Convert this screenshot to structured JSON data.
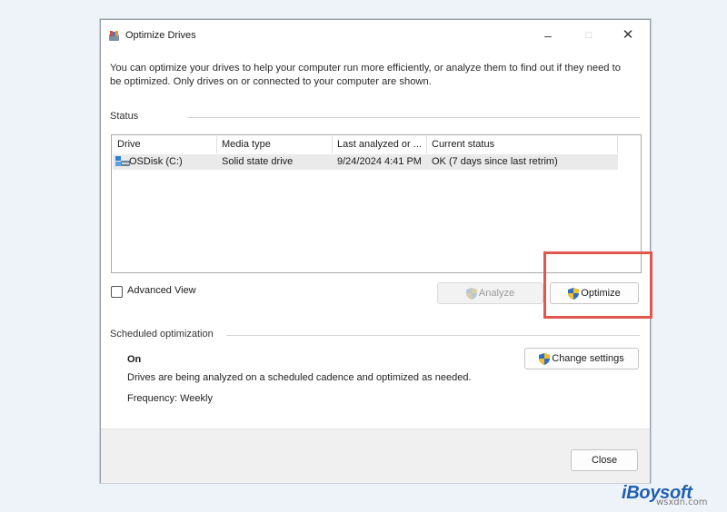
{
  "window": {
    "title": "Optimize Drives",
    "minimize_glyph": "–",
    "maximize_glyph": "□",
    "close_glyph": "✕"
  },
  "description": "You can optimize your drives to help your computer run more efficiently, or analyze them to find out if they need to be optimized. Only drives on or connected to your computer are shown.",
  "status": {
    "label": "Status",
    "columns": [
      "Drive",
      "Media type",
      "Last analyzed or ...",
      "Current status"
    ],
    "rows": [
      {
        "drive": "OSDisk (C:)",
        "media_type": "Solid state drive",
        "last_analyzed": "9/24/2024 4:41 PM",
        "current_status": "OK (7 days since last retrim)"
      }
    ]
  },
  "advanced_view": {
    "label": "Advanced View",
    "checked": false
  },
  "buttons": {
    "analyze": "Analyze",
    "optimize": "Optimize",
    "change_settings": "Change settings",
    "close": "Close"
  },
  "scheduled": {
    "label": "Scheduled optimization",
    "state": "On",
    "description": "Drives are being analyzed on a scheduled cadence and optimized as needed.",
    "frequency": "Frequency: Weekly"
  },
  "highlight_color": "#e0574e",
  "watermark": {
    "brand": "iBoysoft",
    "site": "wsxdn.com"
  }
}
